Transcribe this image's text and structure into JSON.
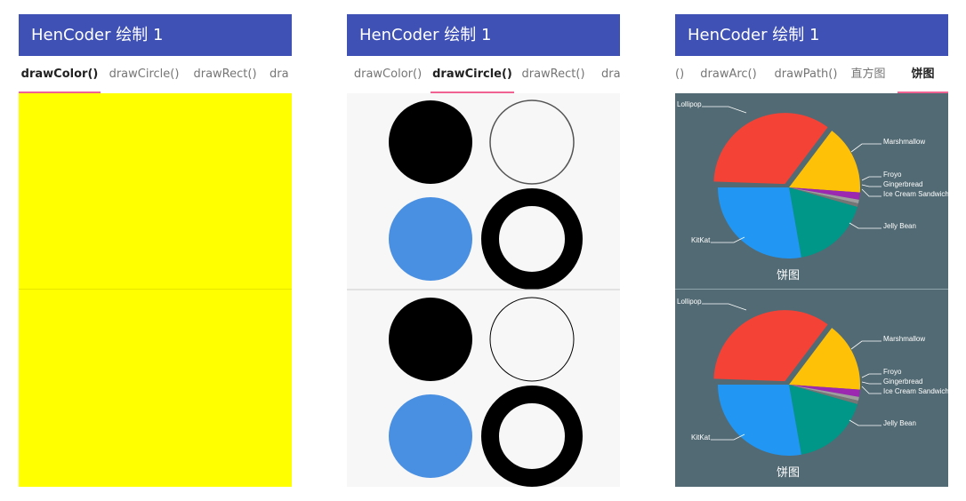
{
  "app_title": "HenCoder 绘制 1",
  "colors": {
    "appbar": "#3f51b5",
    "indicator": "#f06292",
    "yellow": "#ffff00",
    "blue_circle": "#4a90e2",
    "pie_background": "#526a73"
  },
  "screens": [
    {
      "tabs": [
        "drawColor()",
        "drawCircle()",
        "drawRect()",
        "dra"
      ],
      "active_tab": "drawColor()"
    },
    {
      "tabs": [
        "drawColor()",
        "drawCircle()",
        "drawRect()",
        "dra"
      ],
      "active_tab": "drawCircle()"
    },
    {
      "tabs": [
        "()",
        "drawArc()",
        "drawPath()",
        "直方图",
        "饼图"
      ],
      "active_tab": "饼图"
    }
  ],
  "pie": {
    "title": "饼图",
    "labels": {
      "lollipop": "Lollipop",
      "marshmallow": "Marshmallow",
      "froyo": "Froyo",
      "gingerbread": "Gingerbread",
      "ice_cream": "Ice Cream Sandwich",
      "jelly_bean": "Jelly Bean",
      "kitkat": "KitKat"
    },
    "slice_colors": {
      "lollipop": "#f44336",
      "marshmallow": "#ffc107",
      "froyo": "#9c27b0",
      "gingerbread": "#9e9e9e",
      "ice_cream": "#757575",
      "jelly_bean": "#009688",
      "kitkat": "#2196f3"
    }
  }
}
